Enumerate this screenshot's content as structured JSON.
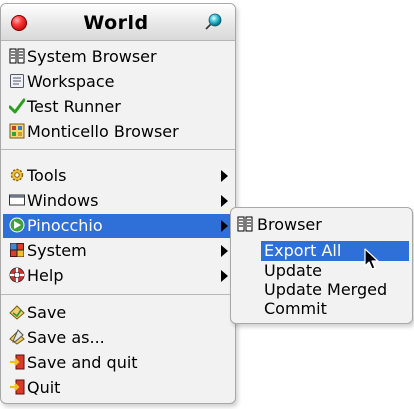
{
  "menu": {
    "title": "World",
    "items": [
      {
        "label": "System Browser",
        "icon": "system-browser-icon"
      },
      {
        "label": "Workspace",
        "icon": "workspace-icon"
      },
      {
        "label": "Test Runner",
        "icon": "test-runner-icon"
      },
      {
        "label": "Monticello Browser",
        "icon": "monticello-icon"
      },
      {
        "label": "Tools",
        "icon": "tools-icon",
        "submenu": true
      },
      {
        "label": "Windows",
        "icon": "windows-icon",
        "submenu": true
      },
      {
        "label": "Pinocchio",
        "icon": "pinocchio-icon",
        "submenu": true,
        "selected": true
      },
      {
        "label": "System",
        "icon": "system-icon",
        "submenu": true
      },
      {
        "label": "Help",
        "icon": "help-icon",
        "submenu": true
      },
      {
        "label": "Save",
        "icon": "save-icon"
      },
      {
        "label": "Save as...",
        "icon": "save-as-icon"
      },
      {
        "label": "Save and quit",
        "icon": "save-and-quit-icon"
      },
      {
        "label": "Quit",
        "icon": "quit-icon"
      }
    ]
  },
  "submenu": {
    "items": [
      {
        "label": "Browser",
        "icon": "browser-icon"
      },
      {
        "label": "Export All",
        "selected": true
      },
      {
        "label": "Update"
      },
      {
        "label": "Update Merged"
      },
      {
        "label": "Commit"
      }
    ]
  },
  "colors": {
    "selection": "#2f6fd8",
    "menu_background": "#f2f2f2",
    "close_button": "#ff3b3b"
  }
}
